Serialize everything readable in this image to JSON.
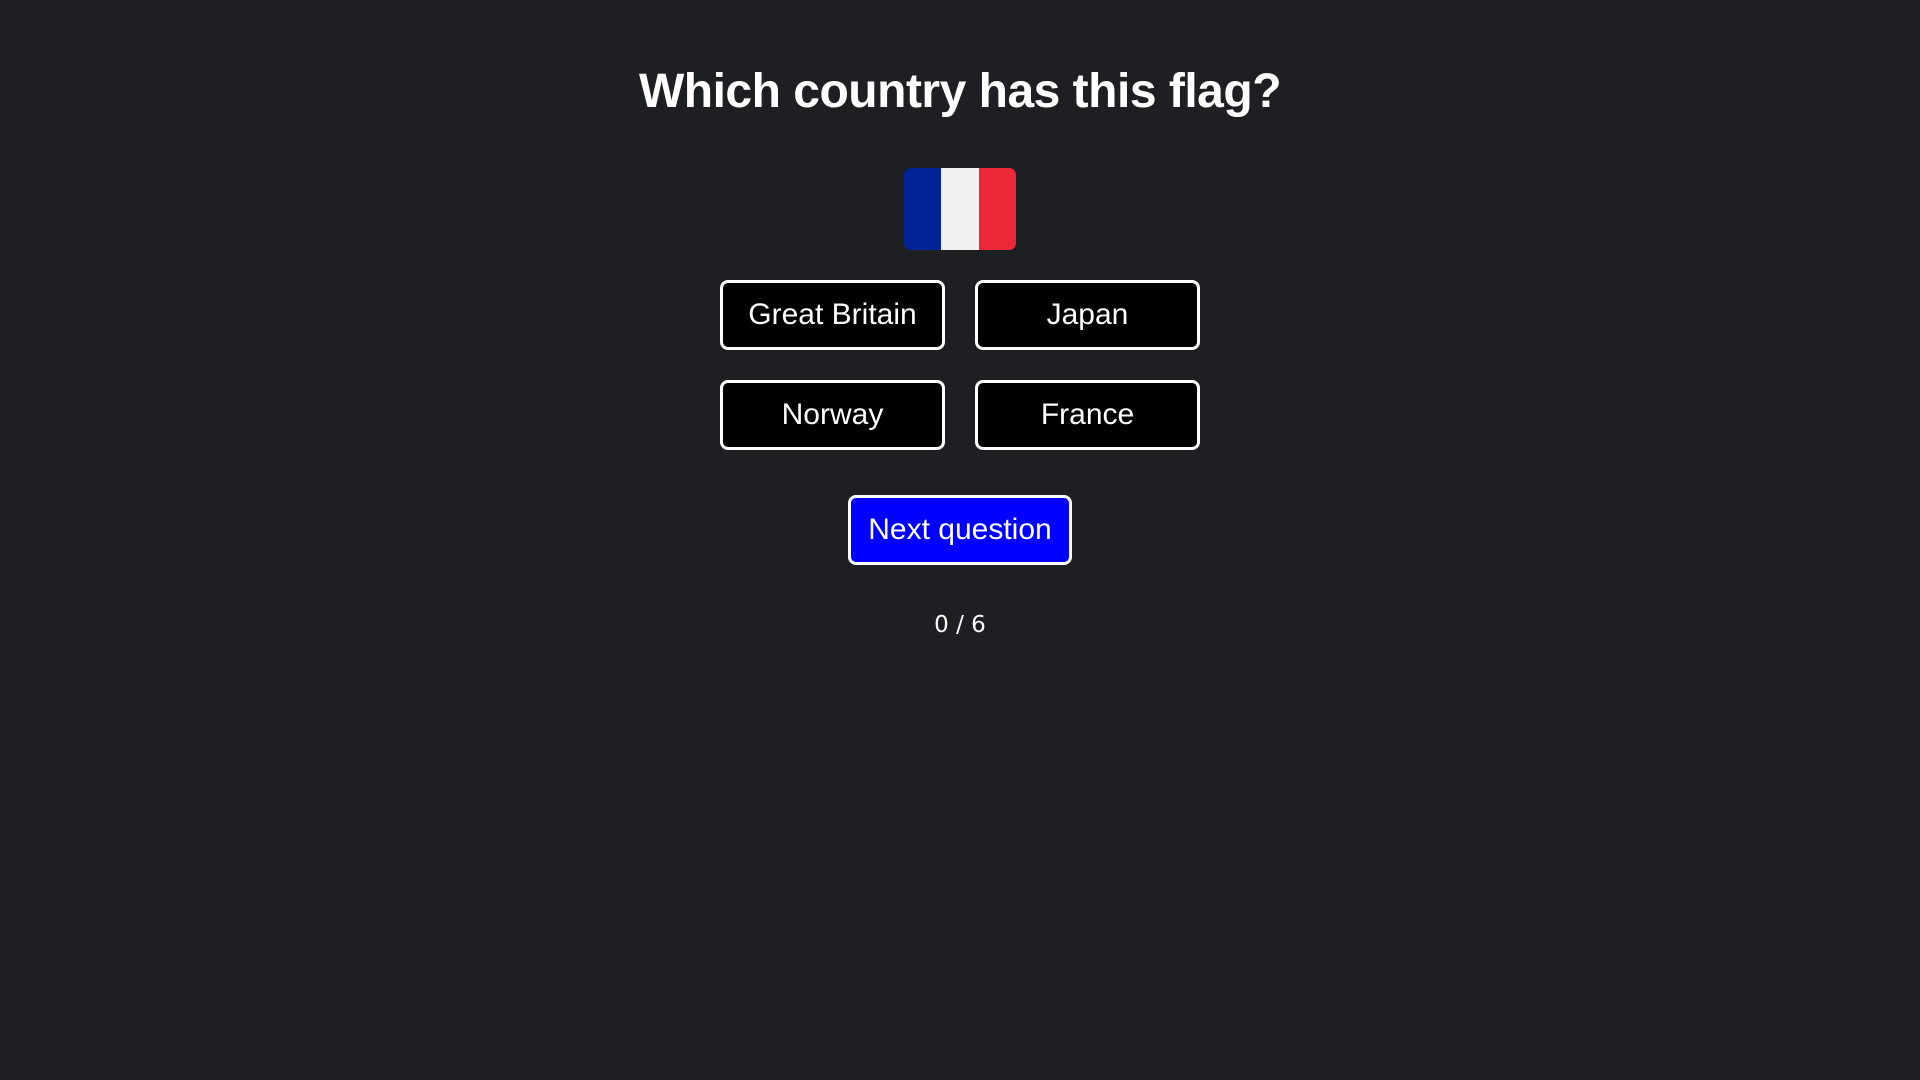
{
  "quiz": {
    "question": "Which country has this flag?",
    "flag": {
      "icon": "france-flag-icon",
      "stripes": [
        "#002395",
        "#f1f1f1",
        "#ed2939"
      ]
    },
    "answers": [
      {
        "label": "Great Britain"
      },
      {
        "label": "Japan"
      },
      {
        "label": "Norway"
      },
      {
        "label": "France"
      }
    ],
    "next_label": "Next question",
    "score_text": "0 / 6"
  },
  "colors": {
    "background": "#1d1f23",
    "answer_button_bg": "#000000",
    "answer_button_border": "#ffffff",
    "next_button_bg": "#0000ff",
    "text": "#ffffff"
  }
}
